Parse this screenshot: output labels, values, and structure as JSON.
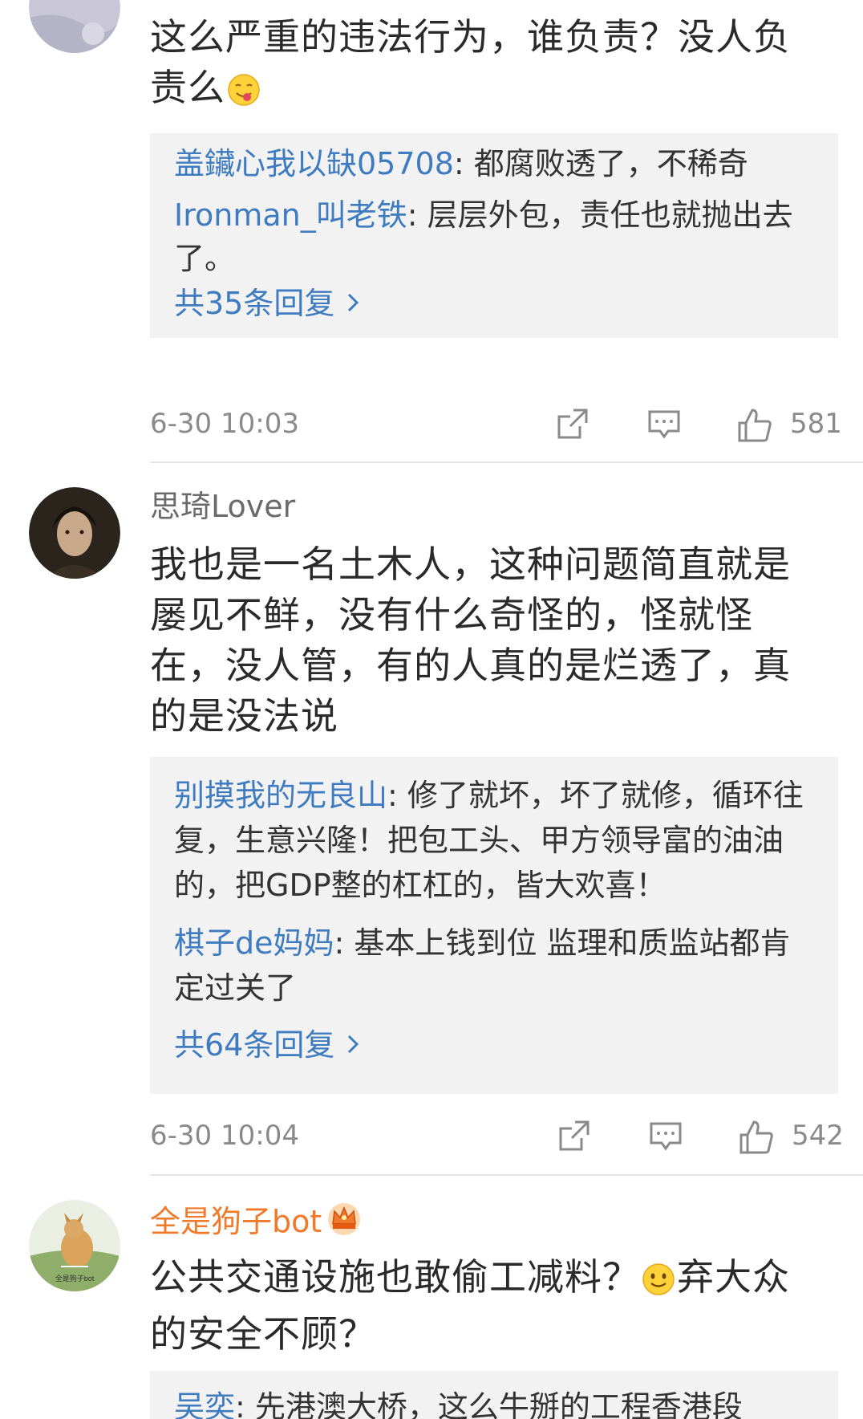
{
  "comments": [
    {
      "username": "",
      "text": "这么严重的违法行为，谁负责？没人负责么",
      "replies": [
        {
          "user": "盖鑶心我以缺05708",
          "text": ": 都腐败透了，不稀奇"
        },
        {
          "user": "Ironman_叫老铁",
          "text": ": 层层外包，责任也就抛出去了。"
        }
      ],
      "more_replies": "共35条回复",
      "timestamp": "6-30 10:03",
      "likes": "581"
    },
    {
      "username": "思琦Lover",
      "text": "我也是一名土木人，这种问题简直就是屡见不鲜，没有什么奇怪的，怪就怪在，没人管，有的人真的是烂透了，真的是没法说",
      "replies": [
        {
          "user": "别摸我的无良山",
          "text": ": 修了就坏，坏了就修，循环往复，生意兴隆！把包工头、甲方领导富的油油的，把GDP整的杠杠的，皆大欢喜！"
        },
        {
          "user": "棋子de妈妈",
          "text": ": 基本上钱到位 监理和质监站都肯定过关了"
        }
      ],
      "more_replies": "共64条回复",
      "timestamp": "6-30 10:04",
      "likes": "542"
    },
    {
      "username": "全是狗子bot",
      "text_part1": "公共交通设施也敢偷工减料？",
      "text_part2": "弃大众的安全不顾？",
      "avatar_caption": "全是狗子bot",
      "replies": [
        {
          "user": "吴奕",
          "text": ": 先港澳大桥，这么牛掰的工程香港段"
        }
      ]
    }
  ],
  "colors": {
    "link": "#3e7bc0",
    "vip_name": "#f07a2a",
    "reply_bg": "#f2f2f2",
    "meta": "#8a8a8a"
  },
  "icons": {
    "forward": "share-icon",
    "comment": "comment-icon",
    "like": "thumbs-up-icon",
    "emoji_tongue": "tongue-emoji-icon",
    "emoji_smile": "smile-emoji-icon",
    "crown": "vip-crown-icon",
    "chevron": "chevron-right-icon"
  }
}
